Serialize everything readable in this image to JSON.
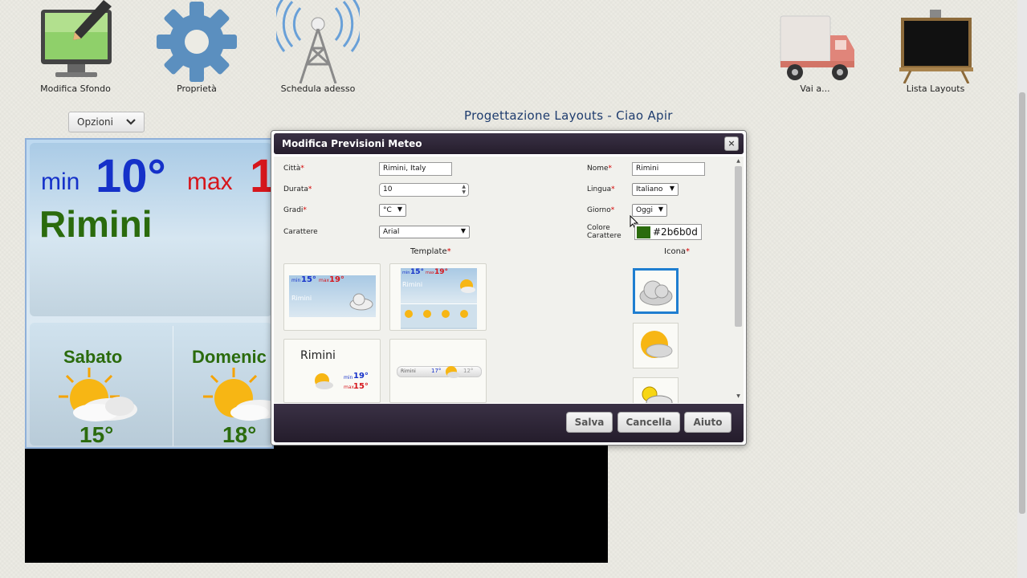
{
  "toolbar": {
    "items": [
      {
        "label": "Modifica Sfondo",
        "icon": "monitor-pencil-icon"
      },
      {
        "label": "Proprietà",
        "icon": "gear-icon"
      },
      {
        "label": "Schedula adesso",
        "icon": "antenna-tower-icon"
      },
      {
        "label": "Vai a...",
        "icon": "truck-icon"
      },
      {
        "label": "Lista Layouts",
        "icon": "blackboard-icon"
      }
    ]
  },
  "options_button": {
    "label": "Opzioni"
  },
  "page_title": "Progettazione Layouts - Ciao Apir",
  "preview": {
    "min_label": "min",
    "min_value": "10°",
    "max_label": "max",
    "max_value": "1",
    "city": "Rimini",
    "days": [
      {
        "name": "Sabato",
        "temp": "15°"
      },
      {
        "name": "Domenic",
        "temp": "18°"
      }
    ]
  },
  "dialog": {
    "title": "Modifica Previsioni Meteo",
    "close_label": "×",
    "fields": {
      "citta": {
        "label": "Città",
        "value": "Rimini, Italy"
      },
      "durata": {
        "label": "Durata",
        "value": "10"
      },
      "gradi": {
        "label": "Gradi",
        "value": "°C"
      },
      "carattere": {
        "label": "Carattere",
        "value": "Arial"
      },
      "nome": {
        "label": "Nome",
        "value": "Rimini"
      },
      "lingua": {
        "label": "Lingua",
        "value": "Italiano"
      },
      "giorno": {
        "label": "Giorno",
        "value": "Oggi"
      },
      "colore": {
        "label_line1": "Colore",
        "label_line2": "Carattere",
        "value": "#2b6b0d",
        "swatch": "#2b6b0d"
      }
    },
    "required_mark": "*",
    "template_label": "Template",
    "icona_label": "Icona",
    "templates": [
      {
        "min": "min",
        "min_val": "15°",
        "max": "max",
        "max_val": "19°",
        "city": "Rimini"
      },
      {
        "min": "min",
        "min_val": "15°",
        "max": "max",
        "max_val": "19°",
        "city": "Rimini"
      },
      {
        "city": "Rimini",
        "min": "min",
        "min_val": "19°",
        "max": "max",
        "max_val": "15°"
      },
      {
        "city": "Rimini",
        "val1": "17°",
        "val2": "12°"
      }
    ],
    "buttons": {
      "save": "Salva",
      "cancel": "Cancella",
      "help": "Aiuto"
    }
  },
  "colors": {
    "title_blue": "#1e3c6e",
    "min_blue": "#1531c9",
    "max_red": "#d6161c",
    "city_green": "#2b6b0d",
    "dialog_header": "#2e2637"
  }
}
